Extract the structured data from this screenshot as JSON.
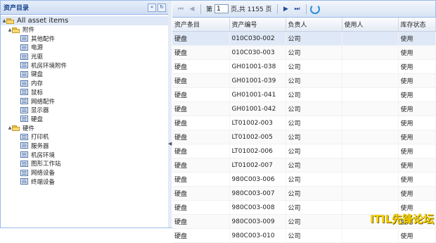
{
  "left_panel": {
    "title": "资产目录",
    "collapse_label": "«",
    "refresh_label": "↻",
    "tree": [
      {
        "type": "root",
        "label": "All asset items",
        "icon": "folder-icon",
        "expand": "▲"
      },
      {
        "type": "folder",
        "label": "附件",
        "icon": "folder-icon",
        "expand": "▲",
        "depth": 1
      },
      {
        "type": "leaf",
        "label": "其他配件",
        "icon": "list-icon",
        "depth": 2
      },
      {
        "type": "leaf",
        "label": "电源",
        "icon": "list-icon",
        "depth": 2
      },
      {
        "type": "leaf",
        "label": "光驱",
        "icon": "list-icon",
        "depth": 2
      },
      {
        "type": "leaf",
        "label": "机房环境附件",
        "icon": "list-icon",
        "depth": 2
      },
      {
        "type": "leaf",
        "label": "键盘",
        "icon": "list-icon",
        "depth": 2
      },
      {
        "type": "leaf",
        "label": "内存",
        "icon": "list-icon",
        "depth": 2
      },
      {
        "type": "leaf",
        "label": "鼠标",
        "icon": "list-icon",
        "depth": 2
      },
      {
        "type": "leaf",
        "label": "网络配件",
        "icon": "list-icon",
        "depth": 2
      },
      {
        "type": "leaf",
        "label": "显示器",
        "icon": "list-icon",
        "depth": 2
      },
      {
        "type": "leaf",
        "label": "硬盘",
        "icon": "list-icon",
        "depth": 2
      },
      {
        "type": "folder",
        "label": "硬件",
        "icon": "folder-icon",
        "expand": "▲",
        "depth": 1
      },
      {
        "type": "leaf",
        "label": "打印机",
        "icon": "list-icon",
        "depth": 2
      },
      {
        "type": "leaf",
        "label": "服务器",
        "icon": "list-icon",
        "depth": 2
      },
      {
        "type": "leaf",
        "label": "机房环境",
        "icon": "list-icon",
        "depth": 2
      },
      {
        "type": "leaf",
        "label": "图形工作站",
        "icon": "list-icon",
        "depth": 2
      },
      {
        "type": "leaf",
        "label": "网络设备",
        "icon": "list-icon",
        "depth": 2
      },
      {
        "type": "leaf",
        "label": "终端设备",
        "icon": "list-icon",
        "depth": 2
      }
    ]
  },
  "splitter": {
    "arrow": "◀"
  },
  "toolbar": {
    "first_icon": "⏮",
    "prev_icon": "◀",
    "next_icon": "▶",
    "last_icon": "⏭",
    "page_prefix": "第",
    "page_value": "1",
    "page_suffix": "页,共 1155 页"
  },
  "grid": {
    "columns": [
      "资产条目",
      "资产编号",
      "负责人",
      "使用人",
      "库存状态"
    ],
    "rows": [
      [
        "硬盘",
        "010C030-002",
        "公司",
        "",
        "使用"
      ],
      [
        "硬盘",
        "010C030-003",
        "公司",
        "",
        "使用"
      ],
      [
        "硬盘",
        "GH01001-038",
        "公司",
        "",
        "使用"
      ],
      [
        "硬盘",
        "GH01001-039",
        "公司",
        "",
        "使用"
      ],
      [
        "硬盘",
        "GH01001-041",
        "公司",
        "",
        "使用"
      ],
      [
        "硬盘",
        "GH01001-042",
        "公司",
        "",
        "使用"
      ],
      [
        "硬盘",
        "LT01002-003",
        "公司",
        "",
        "使用"
      ],
      [
        "硬盘",
        "LT01002-005",
        "公司",
        "",
        "使用"
      ],
      [
        "硬盘",
        "LT01002-006",
        "公司",
        "",
        "使用"
      ],
      [
        "硬盘",
        "LT01002-007",
        "公司",
        "",
        "使用"
      ],
      [
        "硬盘",
        "980C003-006",
        "公司",
        "",
        "使用"
      ],
      [
        "硬盘",
        "980C003-007",
        "公司",
        "",
        "使用"
      ],
      [
        "硬盘",
        "980C003-008",
        "公司",
        "",
        "使用"
      ],
      [
        "硬盘",
        "980C003-009",
        "公司",
        "",
        "使用"
      ],
      [
        "硬盘",
        "980C003-010",
        "公司",
        "",
        "使用"
      ]
    ]
  },
  "watermark": "ITIL先锋论坛",
  "colors": {
    "header_text": "#15428b",
    "selected_row": "#dfe8f6",
    "border": "#99bbe8"
  }
}
